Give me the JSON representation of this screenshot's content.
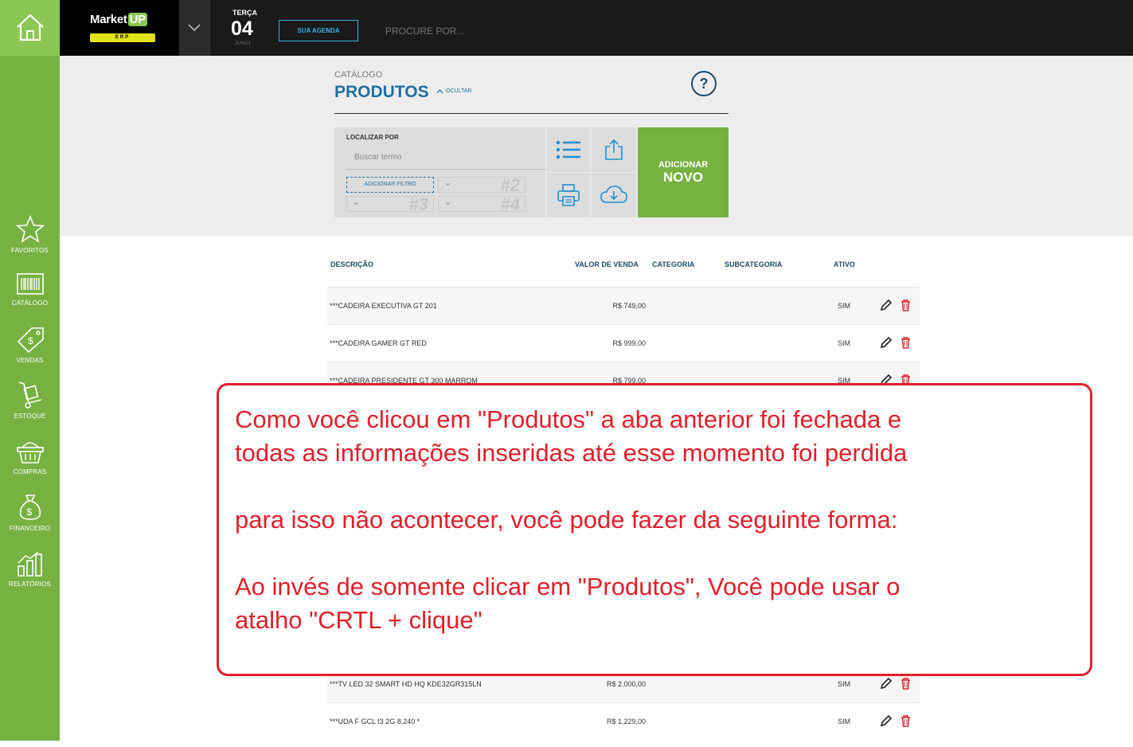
{
  "app": {
    "logo_text": "Market",
    "logo_up": "UP",
    "logo_sub": "ERP"
  },
  "topbar": {
    "day_name": "TERÇA",
    "day_number": "04",
    "month": "JUN/21",
    "agenda_label": "SUA AGENDA",
    "search_placeholder": "PROCURE POR..."
  },
  "sidebar": {
    "items": [
      {
        "label": "FAVORITOS",
        "icon": "star-icon"
      },
      {
        "label": "CATÁLOGO",
        "icon": "barcode-icon"
      },
      {
        "label": "VENDAS",
        "icon": "tag-icon"
      },
      {
        "label": "ESTOQUE",
        "icon": "hand-truck-icon"
      },
      {
        "label": "COMPRAS",
        "icon": "basket-icon"
      },
      {
        "label": "FINANCEIRO",
        "icon": "money-bag-icon"
      },
      {
        "label": "RELATÓRIOS",
        "icon": "bar-chart-icon"
      }
    ]
  },
  "header": {
    "breadcrumb": "CATÁLOGO",
    "title": "PRODUTOS",
    "hide_label": "OCULTAR",
    "help": "?"
  },
  "filter": {
    "label": "LOCALIZAR POR",
    "placeholder": "Buscar termo",
    "add_filter": "ADICIONAR FILTRO",
    "slots": [
      "#2",
      "#3",
      "#4"
    ]
  },
  "actions": {
    "add_line1": "ADICIONAR",
    "add_line2": "NOVO"
  },
  "table": {
    "headers": [
      "DESCRIÇÃO",
      "VALOR DE VENDA",
      "CATEGORIA",
      "SUBCATEGORIA",
      "ATIVO"
    ],
    "rows": [
      {
        "desc": "***CADEIRA EXECUTIVA GT 201",
        "price": "R$ 749,00",
        "active": "SIM"
      },
      {
        "desc": "***CADEIRA GAMER GT RED",
        "price": "R$ 999,00",
        "active": "SIM"
      },
      {
        "desc": "***CADEIRA PRESIDENTE GT 300 MARROM",
        "price": "R$ 799,00",
        "active": "SIM"
      },
      {
        "desc": "***TV LED 32 SMART HD HQ KDE32GR315LN",
        "price": "R$ 2.000,00",
        "active": "SIM"
      },
      {
        "desc": "***UDA F GCL I3 2G 8,240 *",
        "price": "R$ 1.229,00",
        "active": "SIM"
      }
    ]
  },
  "annotation": {
    "line1": "Como você clicou em \"Produtos\" a aba anterior foi fechada e",
    "line2": "todas as informações inseridas até esse momento foi perdida",
    "line3": "para isso não acontecer, você pode fazer da seguinte forma:",
    "line4": "Ao invés de somente clicar em \"Produtos\", Você pode usar o",
    "line5": "atalho \"CRTL + clique\""
  },
  "colors": {
    "green": "#77b142",
    "blue": "#1f6fa0",
    "red": "#e0202a",
    "dark": "#1a1a1a"
  }
}
